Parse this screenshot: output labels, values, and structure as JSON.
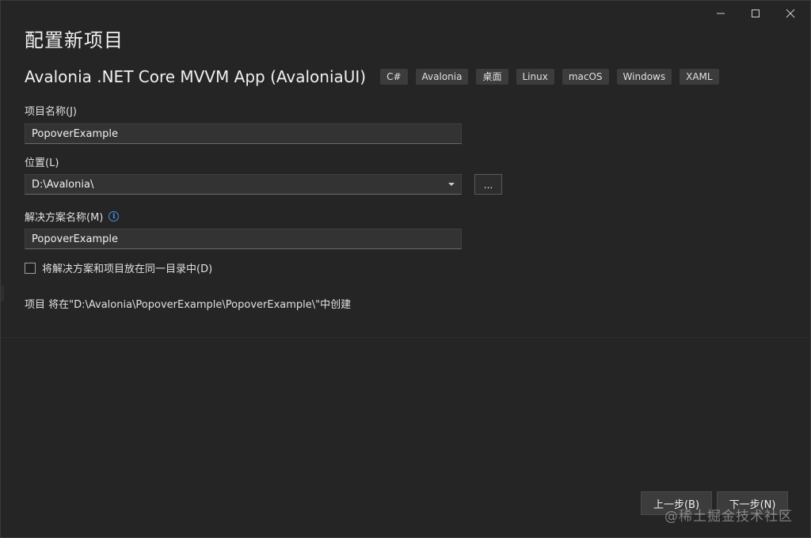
{
  "window": {
    "controls": {
      "minimize_icon": "minimize-icon",
      "maximize_icon": "maximize-icon",
      "close_icon": "close-icon"
    }
  },
  "page": {
    "title": "配置新项目"
  },
  "template": {
    "name": "Avalonia .NET Core MVVM App (AvaloniaUI)",
    "tags": [
      "C#",
      "Avalonia",
      "桌面",
      "Linux",
      "macOS",
      "Windows",
      "XAML"
    ]
  },
  "form": {
    "project_name_label": "项目名称(J)",
    "project_name_value": "PopoverExample",
    "location_label": "位置(L)",
    "location_value": "D:\\Avalonia\\",
    "browse_label": "...",
    "solution_name_label": "解决方案名称(M)",
    "solution_name_value": "PopoverExample",
    "same_dir_label": "将解决方案和项目放在同一目录中(D)",
    "same_dir_checked": false,
    "path_note": "项目 将在\"D:\\Avalonia\\PopoverExample\\PopoverExample\\\"中创建"
  },
  "footer": {
    "prev_label": "上一步(B)",
    "next_label": "下一步(N)"
  },
  "watermark": "@稀土掘金技术社区",
  "colors": {
    "background": "#252526",
    "input_bg": "#333333",
    "tag_bg": "#3c3c3c",
    "info_accent": "#4a90e2"
  }
}
